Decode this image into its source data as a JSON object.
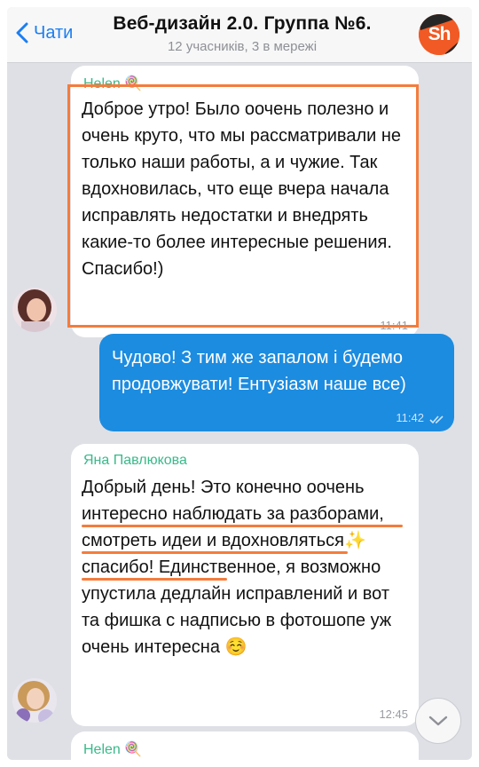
{
  "header": {
    "back_label": "Чати",
    "title": "Веб-дизайн 2.0. Группа №6.",
    "subtitle": "12 учасників, 3 в мережі",
    "group_avatar_text": "Sh"
  },
  "messages": [
    {
      "sender": "Helen 🍭",
      "text": "Доброе утро! Было оочень полезно и очень круто, что мы рассматривали не только наши работы, а и чужие. Так вдохновилась, что еще вчера начала исправлять недостатки и внедрять какие-то более интересные решения. Спасибо!)",
      "time": "11:41"
    },
    {
      "sender": "",
      "text": "Чудово! З тим же запалом і будемо продовжувати! Ентузіазм наше все)",
      "time": "11:42",
      "outgoing": true
    },
    {
      "sender": "Яна Павлюкова",
      "text": "Добрый день! Это конечно оочень интересно наблюдать за разборами, смотреть идеи и вдохновляться✨ спасибо! Единственное, я возможно упустила дедлайн исправлений и вот та фишка с надписью в фотошопе уж очень интересна ☺️",
      "time": "12:45"
    },
    {
      "sender": "Helen 🍭"
    }
  ],
  "colors": {
    "accent": "#1b7ef0",
    "outgoing_bubble": "#1c8ce0",
    "sender_name": "#39b98a",
    "highlight": "#f47c3c",
    "chat_background": "#dee0e6"
  },
  "icons": [
    "chevron-left-icon",
    "double-check-icon",
    "chevron-down-icon"
  ]
}
